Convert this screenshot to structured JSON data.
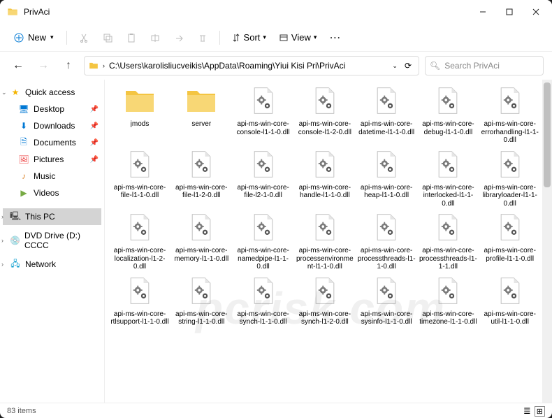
{
  "window": {
    "title": "PrivAci"
  },
  "toolbar": {
    "new": "New",
    "sort": "Sort",
    "view": "View"
  },
  "address": {
    "path": "C:\\Users\\karolisliucveikis\\AppData\\Roaming\\Yiui Kisi Pri\\PrivAci"
  },
  "search": {
    "placeholder": "Search PrivAci"
  },
  "sidebar": {
    "quick": "Quick access",
    "desktop": "Desktop",
    "downloads": "Downloads",
    "documents": "Documents",
    "pictures": "Pictures",
    "music": "Music",
    "videos": "Videos",
    "thispc": "This PC",
    "dvd": "DVD Drive (D:) CCCC",
    "network": "Network"
  },
  "files": [
    {
      "type": "folder",
      "name": "jmods"
    },
    {
      "type": "folder",
      "name": "server"
    },
    {
      "type": "dll",
      "name": "api-ms-win-core-console-l1-1-0.dll"
    },
    {
      "type": "dll",
      "name": "api-ms-win-core-console-l1-2-0.dll"
    },
    {
      "type": "dll",
      "name": "api-ms-win-core-datetime-l1-1-0.dll"
    },
    {
      "type": "dll",
      "name": "api-ms-win-core-debug-l1-1-0.dll"
    },
    {
      "type": "dll",
      "name": "api-ms-win-core-errorhandling-l1-1-0.dll"
    },
    {
      "type": "dll",
      "name": "api-ms-win-core-file-l1-1-0.dll"
    },
    {
      "type": "dll",
      "name": "api-ms-win-core-file-l1-2-0.dll"
    },
    {
      "type": "dll",
      "name": "api-ms-win-core-file-l2-1-0.dll"
    },
    {
      "type": "dll",
      "name": "api-ms-win-core-handle-l1-1-0.dll"
    },
    {
      "type": "dll",
      "name": "api-ms-win-core-heap-l1-1-0.dll"
    },
    {
      "type": "dll",
      "name": "api-ms-win-core-interlocked-l1-1-0.dll"
    },
    {
      "type": "dll",
      "name": "api-ms-win-core-libraryloader-l1-1-0.dll"
    },
    {
      "type": "dll",
      "name": "api-ms-win-core-localization-l1-2-0.dll"
    },
    {
      "type": "dll",
      "name": "api-ms-win-core-memory-l1-1-0.dll"
    },
    {
      "type": "dll",
      "name": "api-ms-win-core-namedpipe-l1-1-0.dll"
    },
    {
      "type": "dll",
      "name": "api-ms-win-core-processenvironment-l1-1-0.dll"
    },
    {
      "type": "dll",
      "name": "api-ms-win-core-processthreads-l1-1-0.dll"
    },
    {
      "type": "dll",
      "name": "api-ms-win-core-processthreads-l1-1-1.dll"
    },
    {
      "type": "dll",
      "name": "api-ms-win-core-profile-l1-1-0.dll"
    },
    {
      "type": "dll",
      "name": "api-ms-win-core-rtlsupport-l1-1-0.dll"
    },
    {
      "type": "dll",
      "name": "api-ms-win-core-string-l1-1-0.dll"
    },
    {
      "type": "dll",
      "name": "api-ms-win-core-synch-l1-1-0.dll"
    },
    {
      "type": "dll",
      "name": "api-ms-win-core-synch-l1-2-0.dll"
    },
    {
      "type": "dll",
      "name": "api-ms-win-core-sysinfo-l1-1-0.dll"
    },
    {
      "type": "dll",
      "name": "api-ms-win-core-timezone-l1-1-0.dll"
    },
    {
      "type": "dll",
      "name": "api-ms-win-core-util-l1-1-0.dll"
    }
  ],
  "status": {
    "count": "83 items"
  },
  "watermark": "pcrisk.com"
}
